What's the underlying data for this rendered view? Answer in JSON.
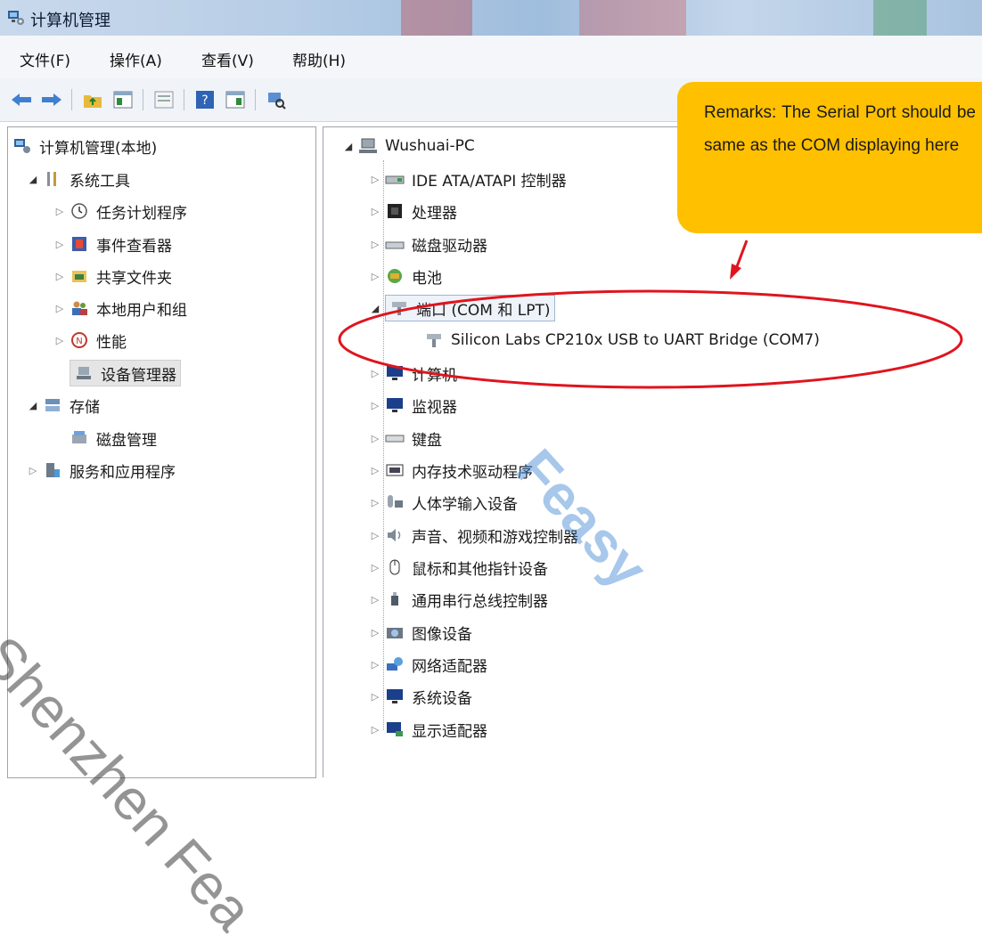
{
  "window": {
    "title": "计算机管理"
  },
  "menu": [
    "文件(F)",
    "操作(A)",
    "查看(V)",
    "帮助(H)"
  ],
  "left_tree": {
    "root": "计算机管理(本地)",
    "system_tools": "系统工具",
    "task_scheduler": "任务计划程序",
    "event_viewer": "事件查看器",
    "shared_folders": "共享文件夹",
    "local_users": "本地用户和组",
    "performance": "性能",
    "device_manager": "设备管理器",
    "storage": "存储",
    "disk_management": "磁盘管理",
    "services_apps": "服务和应用程序"
  },
  "device_tree": {
    "computer_name": "Wushuai-PC",
    "categories": [
      "IDE ATA/ATAPI 控制器",
      "处理器",
      "磁盘驱动器",
      "电池",
      "端口 (COM 和 LPT)",
      "计算机",
      "监视器",
      "键盘",
      "内存技术驱动程序",
      "人体学输入设备",
      "声音、视频和游戏控制器",
      "鼠标和其他指针设备",
      "通用串行总线控制器",
      "图像设备",
      "网络适配器",
      "系统设备",
      "显示适配器"
    ],
    "port_device": "Silicon Labs CP210x USB to UART Bridge (COM7)"
  },
  "callout": {
    "text": "Remarks: The Serial Port should be same as the COM displaying here",
    "color": "#ffc000"
  },
  "annotation_color": "#e0141e",
  "watermarks": [
    "Shenzhen Fea",
    "Feasy"
  ]
}
